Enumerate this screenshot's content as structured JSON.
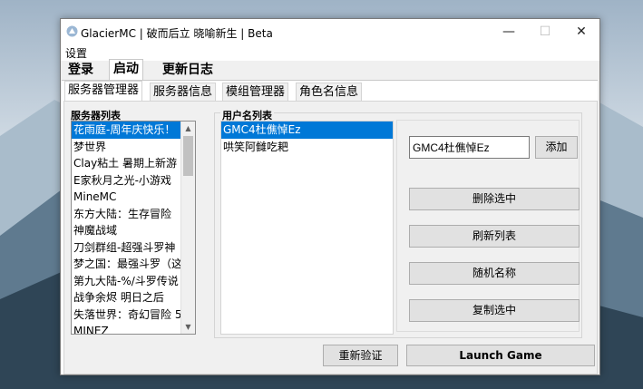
{
  "window": {
    "title": "GlacierMC | 破而后立 晓喻新生 | Beta",
    "controls": {
      "minimize": "—",
      "maximize": "☐",
      "close": "✕"
    }
  },
  "menu": {
    "settings": "设置"
  },
  "main_tabs": [
    {
      "label": "登录",
      "active": false
    },
    {
      "label": "启动",
      "active": true
    },
    {
      "label": "更新日志",
      "active": false
    }
  ],
  "sub_tabs": [
    {
      "label": "服务器管理器",
      "active": true
    },
    {
      "label": "服务器信息",
      "active": false
    },
    {
      "label": "模组管理器",
      "active": false
    },
    {
      "label": "角色名信息",
      "active": false
    }
  ],
  "server_list": {
    "label": "服务器列表",
    "selected_index": 0,
    "items": [
      "花雨庭-周年庆快乐！",
      "梦世界",
      "Clay粘土 暑期上新游",
      "E家秋月之光-小游戏",
      "MineMC",
      "东方大陆：生存冒险",
      "神魔战域",
      "刀剑群组-超强斗罗神",
      "梦之国：最强斗罗（这",
      "第九大陆-%/斗罗传说",
      "战争余烬 明日之后",
      "失落世界：奇幻冒险 5",
      "MINEZ"
    ]
  },
  "user_list": {
    "label": "用户名列表",
    "selected_index": 0,
    "items": [
      "GMC4杜僬悼Ez",
      "哄笑阿雠吃耙"
    ]
  },
  "username_input": {
    "value": "GMC4杜僬悼Ez"
  },
  "buttons": {
    "add": "添加",
    "delete_selected": "删除选中",
    "refresh_list": "刷新列表",
    "random_name": "随机名称",
    "copy_selected": "复制选中",
    "reverify": "重新验证",
    "launch": "Launch Game"
  },
  "colors": {
    "selection": "#0078d7",
    "window_bg": "#f0f0f0"
  }
}
